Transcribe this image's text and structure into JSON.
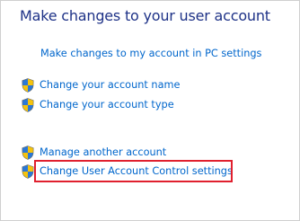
{
  "header": {
    "title": "Make changes to your user account"
  },
  "links": {
    "pc_settings": "Make changes to my account in PC settings",
    "change_name": "Change your account name",
    "change_type": "Change your account type",
    "manage_another": "Manage another account",
    "uac_settings": "Change User Account Control settings"
  },
  "icons": {
    "shield": "uac-shield-icon"
  },
  "colors": {
    "title": "#1e3287",
    "link": "#0066cc",
    "highlight": "#e0202e",
    "shield_blue": "#2b78d6",
    "shield_yellow": "#f5c30d"
  }
}
